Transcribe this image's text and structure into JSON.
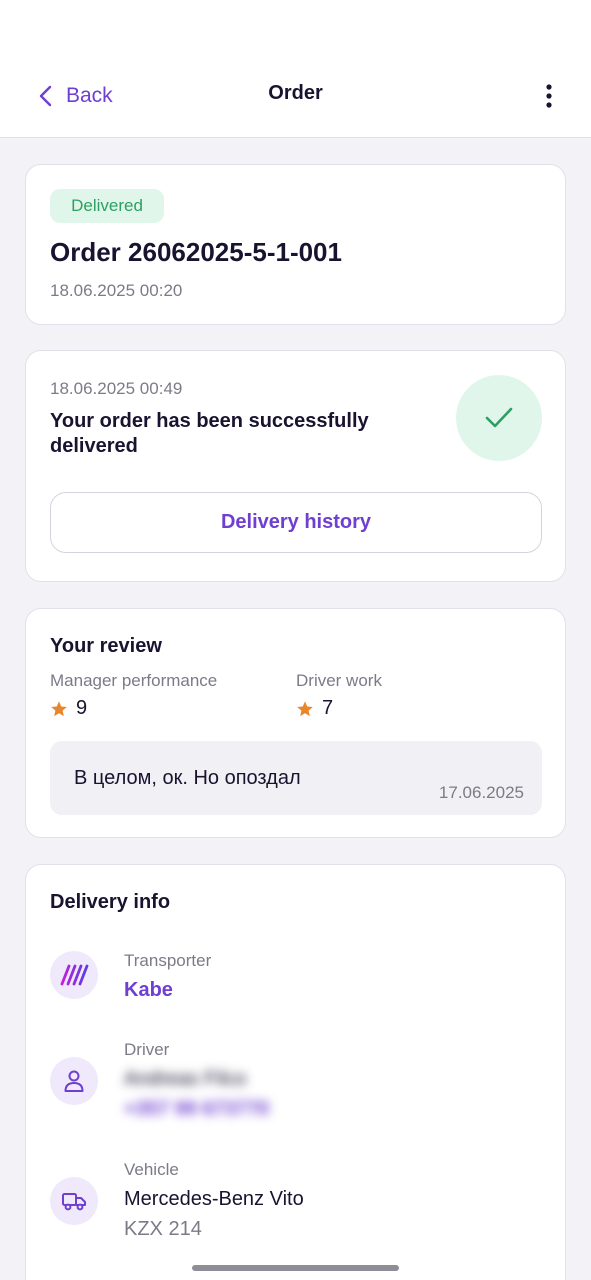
{
  "header": {
    "back_label": "Back",
    "title": "Order"
  },
  "order": {
    "status_badge": "Delivered",
    "title": "Order 26062025-5-1-001",
    "date": "18.06.2025 00:20"
  },
  "delivery_status": {
    "date": "18.06.2025 00:49",
    "message": "Your order has been successfully delivered",
    "history_button": "Delivery history"
  },
  "review": {
    "title": "Your review",
    "manager": {
      "label": "Manager performance",
      "value": "9"
    },
    "driver": {
      "label": "Driver work",
      "value": "7"
    },
    "comment": "В целом, ок. Но опоздал",
    "date": "17.06.2025"
  },
  "delivery_info": {
    "title": "Delivery info",
    "transporter": {
      "label": "Transporter",
      "value": "Kabe"
    },
    "driver": {
      "label": "Driver",
      "name": "Andreas Filco",
      "phone": "+357 99 673770"
    },
    "vehicle": {
      "label": "Vehicle",
      "model": "Mercedes-Benz Vito",
      "plate": "KZX 214"
    }
  },
  "colors": {
    "accent": "#6e3fd0",
    "success": "#2e9f63",
    "success_bg": "#e1f6ea",
    "star": "#e8872a"
  },
  "icons": {
    "back": "chevron-left-icon",
    "more": "more-vertical-icon",
    "delivered": "check-icon",
    "rating": "star-icon",
    "transporter": "transporter-logo-icon",
    "driver": "person-icon",
    "vehicle": "truck-icon"
  }
}
